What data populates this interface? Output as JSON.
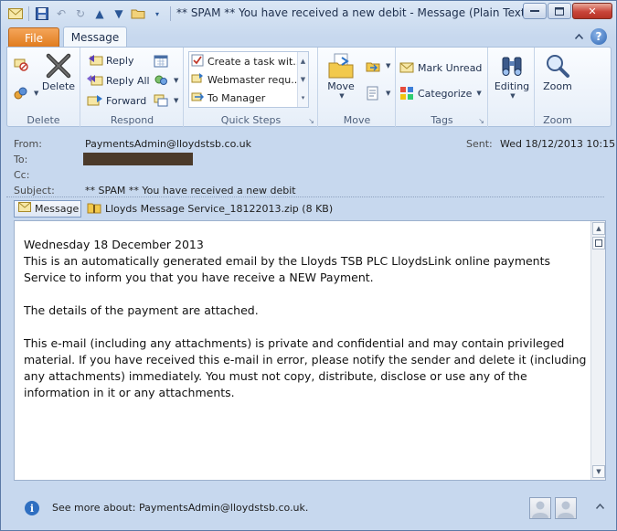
{
  "window": {
    "title": "** SPAM ** You have received a new debit  -  Message (Plain Text)",
    "controls": {
      "minimize": "▭",
      "maximize": "▢",
      "close": "✕"
    }
  },
  "tabs": [
    {
      "label": "File"
    },
    {
      "label": "Message"
    }
  ],
  "help_label": "?",
  "ribbon": {
    "delete": {
      "label": "Delete",
      "delete_button": "Delete"
    },
    "respond": {
      "label": "Respond",
      "reply": "Reply",
      "reply_all": "Reply All",
      "forward": "Forward"
    },
    "quick_steps": {
      "label": "Quick Steps",
      "items": [
        "Create a task wit...",
        "Webmaster requ...",
        "To Manager"
      ]
    },
    "move": {
      "label": "Move",
      "move_button": "Move"
    },
    "tags": {
      "label": "Tags",
      "mark_unread": "Mark Unread",
      "categorize": "Categorize"
    },
    "editing": {
      "label": "",
      "button": "Editing"
    },
    "zoom": {
      "label": "Zoom",
      "button": "Zoom"
    }
  },
  "header": {
    "from_label": "From:",
    "from_value": "PaymentsAdmin@lloydstsb.co.uk",
    "to_label": "To:",
    "cc_label": "Cc:",
    "subject_label": "Subject:",
    "subject_value": "** SPAM ** You have received a new debit",
    "sent_label": "Sent:",
    "sent_value": "Wed 18/12/2013 10:15"
  },
  "attachments": {
    "message_tab": "Message",
    "file": "Lloyds Message Service_18122013.zip (8 KB)"
  },
  "body": {
    "line1": "Wednesday 18 December 2013",
    "para1": "This is an automatically generated email by the Lloyds TSB PLC LloydsLink online payments Service to inform you that you have receive a NEW Payment.",
    "para2": "The details of the payment are attached.",
    "para3": "This e-mail (including any attachments) is private and confidential and may contain privileged material. If you have received this e-mail in error, please notify the sender and delete it (including any attachments) immediately. You must not copy, distribute, disclose or use any of the information in it or any attachments."
  },
  "social": {
    "see_more": "See more about: PaymentsAdmin@lloydstsb.co.uk."
  }
}
